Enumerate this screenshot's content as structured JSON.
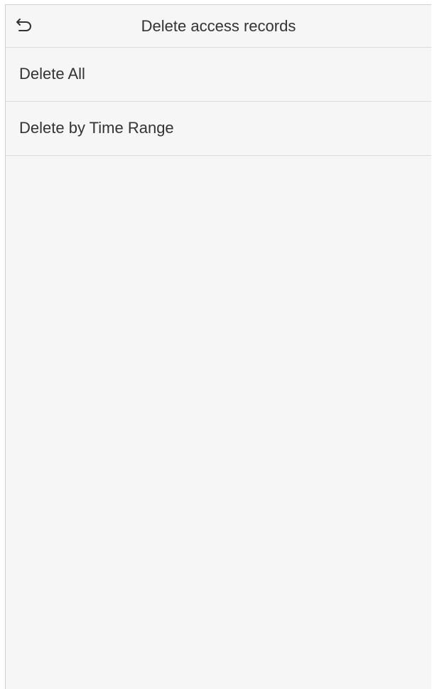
{
  "header": {
    "back_icon": "back-arrow-icon",
    "title": "Delete access records"
  },
  "menu": {
    "items": [
      {
        "label": "Delete All"
      },
      {
        "label": "Delete by Time Range"
      }
    ]
  },
  "colors": {
    "background": "#f6f6f6",
    "text": "#333333",
    "divider": "#dcdcdc"
  }
}
